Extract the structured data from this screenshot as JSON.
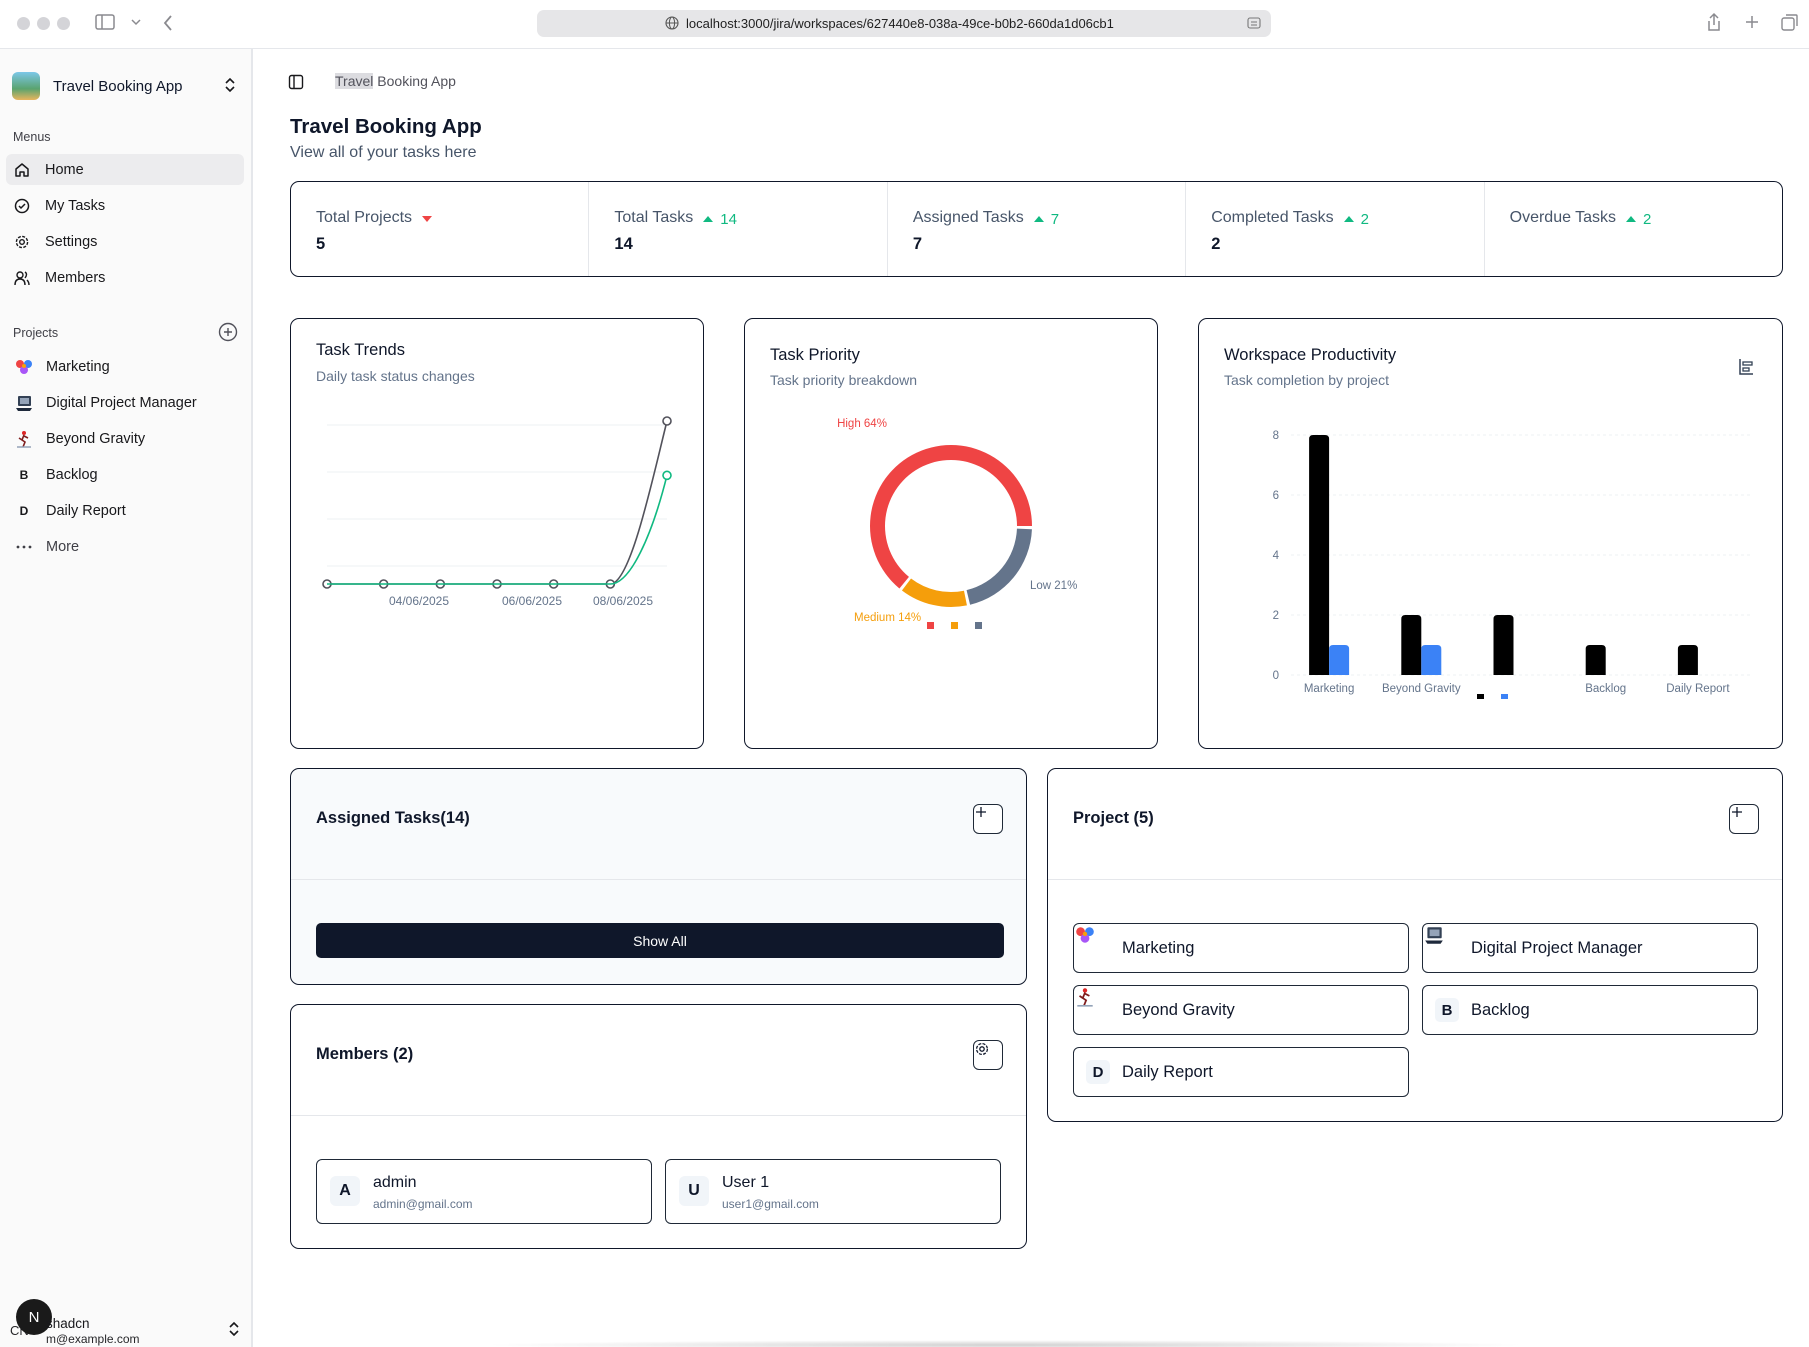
{
  "browser": {
    "url": "localhost:3000/jira/workspaces/627440e8-038a-49ce-b0b2-660da1d06cb1"
  },
  "sidebar": {
    "workspace_name": "Travel Booking App",
    "menus_label": "Menus",
    "menu_items": [
      {
        "label": "Home",
        "icon": "home-icon"
      },
      {
        "label": "My Tasks",
        "icon": "check-circle-icon"
      },
      {
        "label": "Settings",
        "icon": "gear-icon"
      },
      {
        "label": "Members",
        "icon": "users-icon"
      }
    ],
    "projects_label": "Projects",
    "projects": [
      {
        "label": "Marketing",
        "icon": "marketing-logo-icon"
      },
      {
        "label": "Digital Project Manager",
        "icon": "laptop-logo-icon"
      },
      {
        "label": "Beyond Gravity",
        "icon": "runner-logo-icon"
      },
      {
        "label": "Backlog",
        "letter": "B"
      },
      {
        "label": "Daily Report",
        "letter": "D"
      }
    ],
    "more_label": "More",
    "user": {
      "avatar_letter": "N",
      "initials": "CN",
      "name": "shadcn",
      "email": "m@example.com"
    }
  },
  "header": {
    "breadcrumb_highlight": "Travel",
    "breadcrumb_rest": " Booking App"
  },
  "page": {
    "title": "Travel Booking App",
    "subtitle": "View all of your tasks here"
  },
  "stats": [
    {
      "label": "Total Projects",
      "value": "5",
      "trend": "down",
      "trend_value": ""
    },
    {
      "label": "Total Tasks",
      "value": "14",
      "trend": "up",
      "trend_value": "14"
    },
    {
      "label": "Assigned Tasks",
      "value": "7",
      "trend": "up",
      "trend_value": "7"
    },
    {
      "label": "Completed Tasks",
      "value": "2",
      "trend": "up",
      "trend_value": "2"
    },
    {
      "label": "Overdue Tasks",
      "value": "",
      "trend": "up",
      "trend_value": "2"
    }
  ],
  "colors": {
    "up": "#10b981",
    "down": "#ef4444",
    "high": "#ef4444",
    "medium": "#f59e0b",
    "low": "#64748b",
    "total_bar": "#000000",
    "completed_bar": "#3b82f6",
    "trend_line_1": "#52525b",
    "trend_line_2": "#10b981"
  },
  "chart_data": [
    {
      "type": "line",
      "title": "Task Trends",
      "subtitle": "Daily task status changes",
      "x": [
        "",
        "04/06/2025",
        "",
        "06/06/2025",
        "",
        "08/06/2025"
      ],
      "series": [
        {
          "values": [
            0,
            0,
            0,
            0,
            0,
            0,
            6
          ]
        },
        {
          "values": [
            0,
            0,
            0,
            0,
            0,
            0,
            4
          ]
        }
      ],
      "ylim": [
        0,
        6
      ],
      "grid": true
    },
    {
      "type": "pie",
      "title": "Task Priority",
      "subtitle": "Task priority breakdown",
      "slices": [
        {
          "label": "High 64%",
          "value": 64
        },
        {
          "label": "Medium 14%",
          "value": 14
        },
        {
          "label": "Low 21%",
          "value": 21
        }
      ]
    },
    {
      "type": "bar",
      "title": "Workspace Productivity",
      "subtitle": "Task completion by project",
      "categories": [
        "Marketing",
        "Beyond Gravity",
        "",
        "Backlog",
        "Daily Report"
      ],
      "series": [
        {
          "values": [
            8,
            2,
            2,
            1,
            1
          ]
        },
        {
          "values": [
            1,
            1,
            0,
            0,
            0
          ]
        }
      ],
      "yticks": [
        "0",
        "2",
        "4",
        "6",
        "8"
      ],
      "ylim": [
        0,
        8
      ],
      "grid": true
    }
  ],
  "assigned_tasks": {
    "title": "Assigned Tasks(14)",
    "show_all_label": "Show All"
  },
  "members_section": {
    "title": "Members (2)",
    "members": [
      {
        "letter": "A",
        "name": "admin",
        "email": "admin@gmail.com"
      },
      {
        "letter": "U",
        "name": "User 1",
        "email": "user1@gmail.com"
      }
    ]
  },
  "projects_section": {
    "title": "Project (5)",
    "projects": [
      {
        "name": "Marketing",
        "icon": "marketing-logo-icon"
      },
      {
        "name": "Digital Project Manager",
        "icon": "laptop-logo-icon"
      },
      {
        "name": "Beyond Gravity",
        "icon": "runner-logo-icon"
      },
      {
        "name": "Backlog",
        "letter": "B"
      },
      {
        "name": "Daily Report",
        "letter": "D"
      }
    ]
  }
}
